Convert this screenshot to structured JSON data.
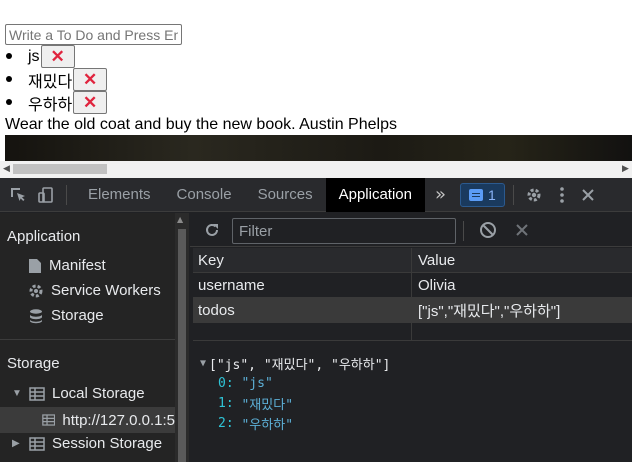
{
  "page": {
    "input_placeholder": "Write a To Do and Press Ent",
    "todos": [
      {
        "text": "js",
        "delete_label": "✕"
      },
      {
        "text": "재밌다",
        "delete_label": "✕"
      },
      {
        "text": "우하하",
        "delete_label": "✕"
      }
    ],
    "quote": "Wear the old coat and buy the new book. Austin Phelps"
  },
  "devtools": {
    "tabs": [
      "Elements",
      "Console",
      "Sources",
      "Application"
    ],
    "active_tab": "Application",
    "more_tabs": "»",
    "issues_count": "1",
    "sidebar": {
      "application_heading": "Application",
      "application_items": [
        "Manifest",
        "Service Workers",
        "Storage"
      ],
      "storage_heading": "Storage",
      "local_storage": "Local Storage",
      "local_storage_origin": "http://127.0.0.1:5",
      "session_storage": "Session Storage"
    },
    "storage": {
      "filter_placeholder": "Filter",
      "columns": {
        "key": "Key",
        "value": "Value"
      },
      "rows": [
        {
          "key": "username",
          "value": "Olivia"
        },
        {
          "key": "todos",
          "value": "[\"js\",\"재밌다\",\"우하하\"]"
        }
      ],
      "preview": {
        "summary": "[\"js\", \"재밌다\", \"우하하\"]",
        "items": [
          {
            "index": "0:",
            "value": "\"js\""
          },
          {
            "index": "1:",
            "value": "\"재밌다\""
          },
          {
            "index": "2:",
            "value": "\"우하하\""
          }
        ]
      }
    }
  },
  "colors": {
    "delete_x": "#e0243e",
    "devtools_bg": "#202124",
    "active_tab_bg": "#000000",
    "preview_index": "#2fc4d6"
  }
}
